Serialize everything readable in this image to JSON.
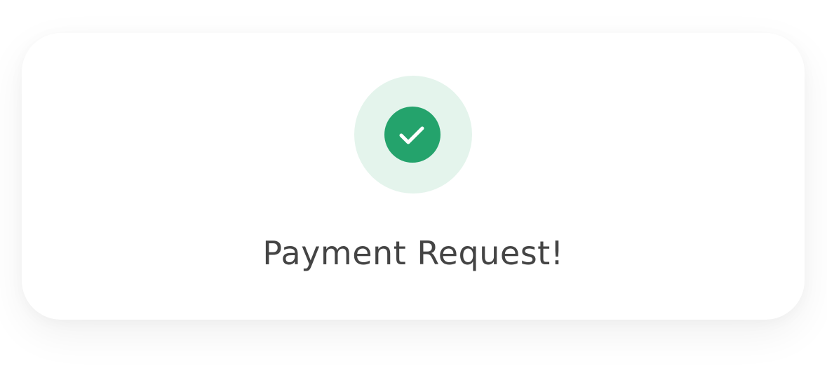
{
  "dialog": {
    "status_icon": "check-icon",
    "title": "Payment Request!"
  },
  "colors": {
    "success": "#24a36c",
    "success_halo": "#e4f4ec",
    "title_text": "#444444",
    "card_background": "#ffffff"
  }
}
